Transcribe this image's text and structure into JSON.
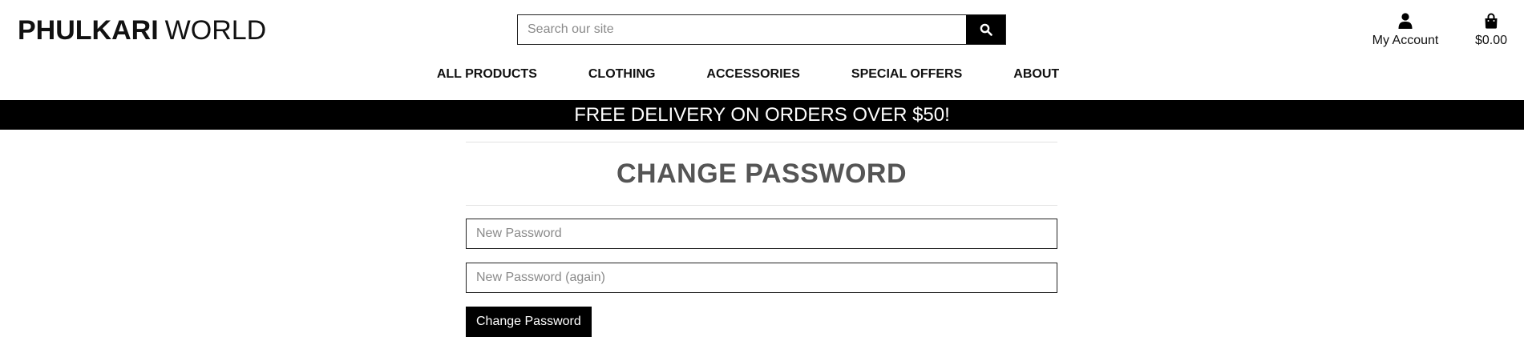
{
  "brand": {
    "bold": "PHULKARI",
    "light": "WORLD"
  },
  "search": {
    "placeholder": "Search our site",
    "icon": "search-icon"
  },
  "account": {
    "label": "My Account",
    "icon": "user-icon"
  },
  "cart": {
    "total": "$0.00",
    "icon": "shopping-bag-icon"
  },
  "nav": {
    "items": [
      {
        "label": "ALL PRODUCTS"
      },
      {
        "label": "CLOTHING"
      },
      {
        "label": "ACCESSORIES"
      },
      {
        "label": "SPECIAL OFFERS"
      },
      {
        "label": "ABOUT"
      }
    ]
  },
  "banner": {
    "text": "FREE DELIVERY ON ORDERS OVER $50!"
  },
  "form": {
    "title": "CHANGE PASSWORD",
    "password1_placeholder": "New Password",
    "password2_placeholder": "New Password (again)",
    "submit_label": "Change Password"
  },
  "colors": {
    "banner_bg": "#000000",
    "button_bg": "#000000",
    "title": "#555555"
  }
}
